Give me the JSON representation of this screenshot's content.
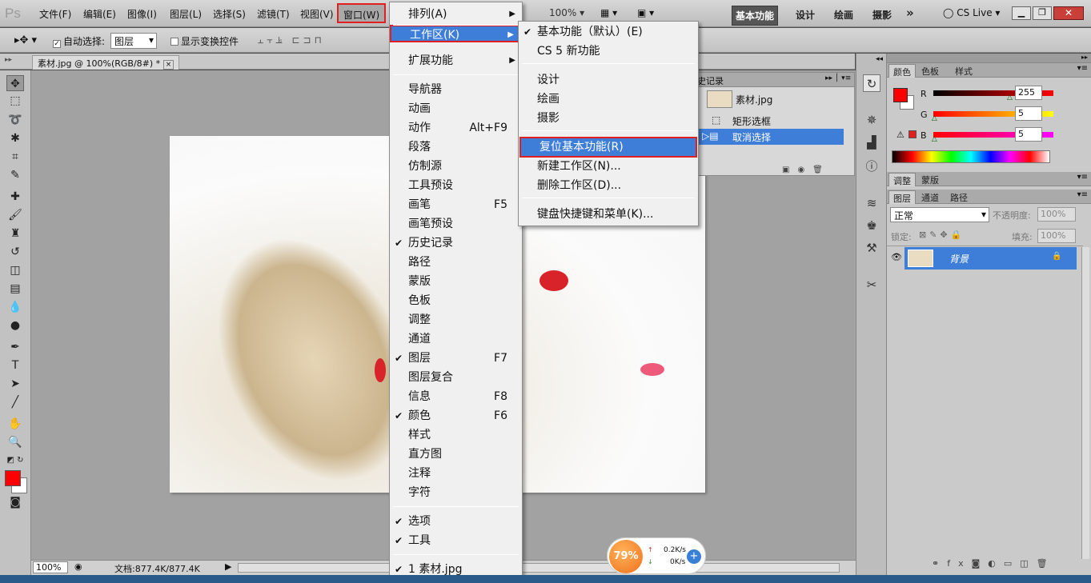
{
  "app": {
    "logo": "Ps"
  },
  "menubar": {
    "items": [
      "文件(F)",
      "编辑(E)",
      "图像(I)",
      "图层(L)",
      "选择(S)",
      "滤镜(T)",
      "视图(V)",
      "窗口(W)"
    ],
    "zoom": "100%",
    "workspaces": [
      "基本功能",
      "设计",
      "绘画",
      "摄影"
    ],
    "more": "»",
    "cslive": "CS Live"
  },
  "options": {
    "auto_select_label": "自动选择:",
    "auto_select_value": "图层",
    "show_transform_label": "显示变换控件"
  },
  "document": {
    "tab_title": "素材.jpg @ 100%(RGB/8#) *",
    "close": "×"
  },
  "window_menu": {
    "items": [
      {
        "label": "排列(A)",
        "submenu": true
      },
      {
        "label": "工作区(K)",
        "submenu": true,
        "highlight": true
      },
      {
        "label": "扩展功能",
        "submenu": true
      },
      {
        "label": "导航器"
      },
      {
        "label": "动画"
      },
      {
        "label": "动作",
        "shortcut": "Alt+F9"
      },
      {
        "label": "段落"
      },
      {
        "label": "仿制源"
      },
      {
        "label": "工具预设"
      },
      {
        "label": "画笔",
        "shortcut": "F5"
      },
      {
        "label": "画笔预设"
      },
      {
        "label": "历史记录",
        "checked": true
      },
      {
        "label": "路径"
      },
      {
        "label": "蒙版"
      },
      {
        "label": "色板"
      },
      {
        "label": "调整"
      },
      {
        "label": "通道"
      },
      {
        "label": "图层",
        "shortcut": "F7",
        "checked": true
      },
      {
        "label": "图层复合"
      },
      {
        "label": "信息",
        "shortcut": "F8"
      },
      {
        "label": "颜色",
        "shortcut": "F6",
        "checked": true
      },
      {
        "label": "样式"
      },
      {
        "label": "直方图"
      },
      {
        "label": "注释"
      },
      {
        "label": "字符"
      },
      {
        "label": "选项",
        "checked": true
      },
      {
        "label": "工具",
        "checked": true
      },
      {
        "label": "1 素材.jpg",
        "checked": true
      }
    ]
  },
  "workspace_submenu": {
    "items": [
      {
        "label": "基本功能（默认）(E)",
        "checked": true
      },
      {
        "label": "CS 5 新功能"
      },
      {
        "label": "设计"
      },
      {
        "label": "绘画"
      },
      {
        "label": "摄影"
      },
      {
        "label": "复位基本功能(R)",
        "highlight": true
      },
      {
        "label": "新建工作区(N)..."
      },
      {
        "label": "删除工作区(D)..."
      },
      {
        "label": "键盘快捷键和菜单(K)..."
      }
    ]
  },
  "history_panel": {
    "tab": "史记录",
    "snapshot": "素材.jpg",
    "steps": [
      "矩形选框",
      "取消选择"
    ]
  },
  "color_panel": {
    "tabs": [
      "颜色",
      "色板",
      "样式"
    ],
    "r": "255",
    "g": "5",
    "b": "5",
    "r_label": "R",
    "g_label": "G",
    "b_label": "B",
    "fg_color": "#ff0000",
    "r_level": 1.0,
    "g_level": 0.02,
    "b_level": 0.02
  },
  "adjust_panel": {
    "tabs": [
      "调整",
      "蒙版"
    ]
  },
  "layers_panel": {
    "tabs": [
      "图层",
      "通道",
      "路径"
    ],
    "blend_mode": "正常",
    "opacity_label": "不透明度:",
    "opacity": "100%",
    "lock_label": "锁定:",
    "fill_label": "填充:",
    "fill": "100%",
    "layer_name": "背景"
  },
  "statusbar": {
    "zoom": "100%",
    "doc_info": "文档:877.4K/877.4K"
  },
  "speed_widget": {
    "percent": "79%",
    "up": "0.2K/s",
    "down": "0K/s"
  }
}
